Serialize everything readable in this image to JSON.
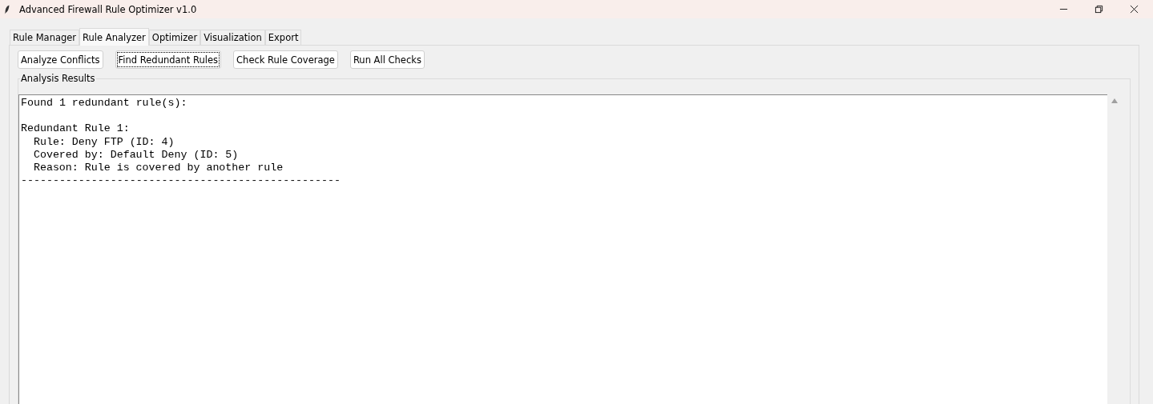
{
  "window": {
    "title": "Advanced Firewall Rule Optimizer v1.0"
  },
  "tabs": [
    {
      "label": "Rule Manager",
      "selected": false
    },
    {
      "label": "Rule Analyzer",
      "selected": true
    },
    {
      "label": "Optimizer",
      "selected": false
    },
    {
      "label": "Visualization",
      "selected": false
    },
    {
      "label": "Export",
      "selected": false
    }
  ],
  "buttons": [
    {
      "label": "Analyze Conflicts",
      "focused": false
    },
    {
      "label": "Find Redundant Rules",
      "focused": true
    },
    {
      "label": "Check Rule Coverage",
      "focused": false
    },
    {
      "label": "Run All Checks",
      "focused": false
    }
  ],
  "results": {
    "title": "Analysis Results",
    "lines": [
      {
        "kind": "summary",
        "text": "Found 1 redundant rule(s):"
      },
      {
        "kind": "heading",
        "text": "Redundant Rule 1:"
      },
      {
        "kind": "detail",
        "text": "Rule: Deny FTP (ID: 4)"
      },
      {
        "kind": "detail",
        "text": "Covered by: Default Deny (ID: 5)"
      },
      {
        "kind": "detail",
        "text": "Reason: Rule is covered by another rule"
      },
      {
        "kind": "separator",
        "text": "--------------------------------------------------"
      }
    ]
  }
}
